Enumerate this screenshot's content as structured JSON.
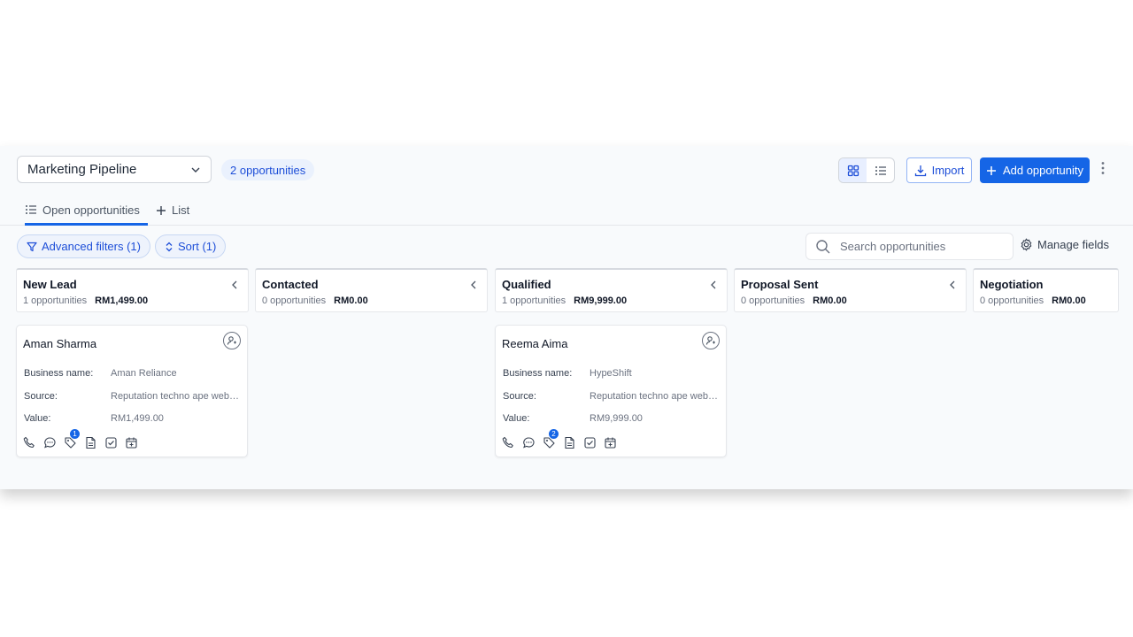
{
  "header": {
    "pipeline": "Marketing Pipeline",
    "count_label": "2 opportunities",
    "import_label": "Import",
    "add_label": "Add opportunity"
  },
  "tabs": [
    {
      "label": "Open opportunities",
      "active": true
    },
    {
      "label": "List",
      "active": false
    }
  ],
  "filters": {
    "advanced_label": "Advanced filters (1)",
    "sort_label": "Sort (1)",
    "search_placeholder": "Search opportunities",
    "manage_label": "Manage fields"
  },
  "columns": [
    {
      "name": "New Lead",
      "count": "1 opportunities",
      "value": "RM1,499.00"
    },
    {
      "name": "Contacted",
      "count": "0 opportunities",
      "value": "RM0.00"
    },
    {
      "name": "Qualified",
      "count": "1 opportunities",
      "value": "RM9,999.00"
    },
    {
      "name": "Proposal Sent",
      "count": "0 opportunities",
      "value": "RM0.00"
    },
    {
      "name": "Negotiation",
      "count": "0 opportunities",
      "value": "RM0.00"
    }
  ],
  "cards": [
    {
      "name": "Aman Sharma",
      "business_label": "Business name:",
      "business": "Aman Reliance",
      "source_label": "Source:",
      "source": "Reputation techno ape website",
      "value_label": "Value:",
      "value": "RM1,499.00",
      "badge": "1"
    },
    {
      "name": "Reema Aima",
      "business_label": "Business name:",
      "business": "HypeShift",
      "source_label": "Source:",
      "source": "Reputation techno ape website",
      "value_label": "Value:",
      "value": "RM9,999.00",
      "badge": "2"
    }
  ],
  "colors": {
    "accent": "#1565e6",
    "pill_bg": "#eaf1fd"
  }
}
